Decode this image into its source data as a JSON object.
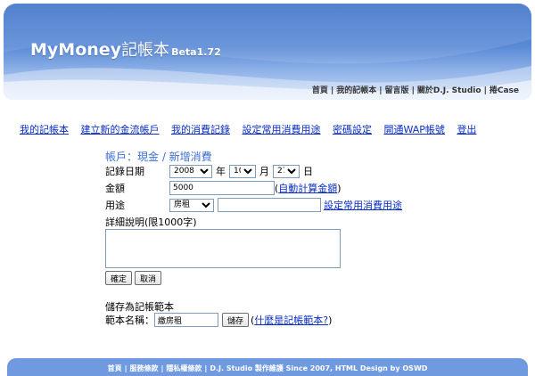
{
  "header": {
    "logo_main": "MyMoney",
    "logo_cn": "記帳本",
    "logo_version": "Beta1.72",
    "nav": [
      "首頁",
      "我的記帳本",
      "留言版",
      "關於D.J. Studio",
      "捲Case"
    ]
  },
  "menu": [
    "我的記帳本",
    "建立新的金流帳戶",
    "我的消費記錄",
    "設定常用消費用途",
    "密碼設定",
    "開通WAP帳號",
    "登出"
  ],
  "form": {
    "title": "帳戶：現金 / 新增消費",
    "date_label": "記錄日期",
    "year": "2008",
    "year_unit": "年",
    "month": "10",
    "month_unit": "月",
    "day": "27",
    "day_unit": "日",
    "amount_label": "金額",
    "amount_value": "5000",
    "auto_calc_link": "自動計算金額",
    "purpose_label": "用途",
    "purpose_selected": "房租",
    "purpose_custom_value": "",
    "purpose_setting_link": "設定常用消費用途",
    "detail_label": "詳細說明(限1000字)",
    "detail_value": "",
    "confirm_button": "確定",
    "cancel_button": "取消"
  },
  "template": {
    "section_title": "儲存為記帳範本",
    "name_label": "範本名稱：",
    "name_value": "繳房租",
    "save_button": "儲存",
    "help_link": "什麼是記帳範本?"
  },
  "footer": {
    "links": [
      "首頁",
      "服務條款",
      "隱私權條款"
    ],
    "credit": "D.J. Studio 製作維護 Since 2007, HTML Design by OSWD"
  },
  "colors": {
    "header_blue": "#3f73c8",
    "link_blue": "#0a2ec4",
    "title_blue": "#3c6fd1",
    "footer_blue": "#6f9ae0"
  }
}
